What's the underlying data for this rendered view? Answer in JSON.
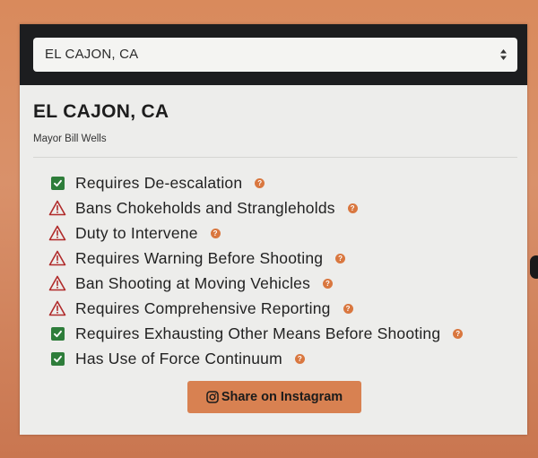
{
  "location_select": {
    "selected": "EL CAJON, CA"
  },
  "city": {
    "name": "EL CAJON, CA",
    "mayor": "Mayor Bill Wells"
  },
  "policies": [
    {
      "label": "Requires De-escalation",
      "status": "yes"
    },
    {
      "label": "Bans Chokeholds and Strangleholds",
      "status": "no"
    },
    {
      "label": "Duty to Intervene",
      "status": "no"
    },
    {
      "label": "Requires Warning Before Shooting",
      "status": "no"
    },
    {
      "label": "Ban Shooting at Moving Vehicles",
      "status": "no"
    },
    {
      "label": "Requires Comprehensive Reporting",
      "status": "no"
    },
    {
      "label": "Requires Exhausting Other Means Before Shooting",
      "status": "yes"
    },
    {
      "label": "Has Use of Force Continuum",
      "status": "yes"
    }
  ],
  "help_icon": "question-mark",
  "share_button": {
    "label": "Share on Instagram",
    "icon": "instagram-icon"
  },
  "colors": {
    "check_green": "#2e7d3a",
    "warning_red": "#b02a2a",
    "accent_orange": "#d88151"
  }
}
